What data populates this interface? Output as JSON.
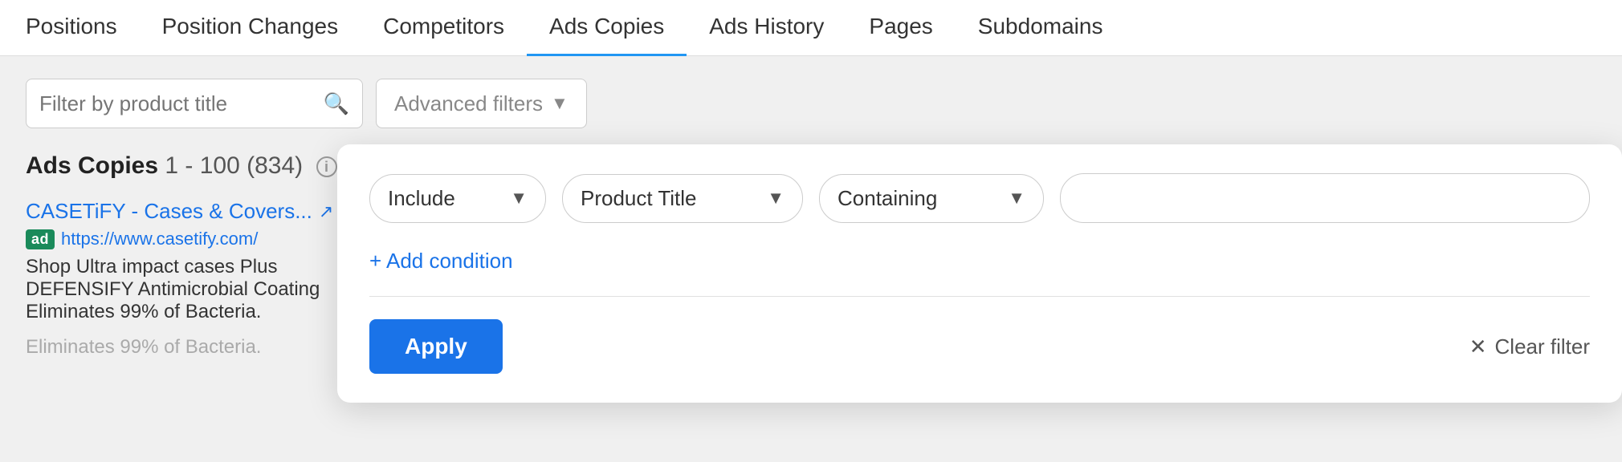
{
  "nav": {
    "items": [
      {
        "label": "Positions",
        "active": false
      },
      {
        "label": "Position Changes",
        "active": false
      },
      {
        "label": "Competitors",
        "active": false
      },
      {
        "label": "Ads Copies",
        "active": true
      },
      {
        "label": "Ads History",
        "active": false
      },
      {
        "label": "Pages",
        "active": false
      },
      {
        "label": "Subdomains",
        "active": false
      }
    ]
  },
  "search": {
    "placeholder": "Filter by product title",
    "icon": "🔍"
  },
  "advanced_filters": {
    "label": "Advanced filters",
    "chevron": "▾"
  },
  "ads_copies_header": {
    "title": "Ads Copies",
    "range": "1 - 100",
    "total": "(834)"
  },
  "ad_item": {
    "title": "CASETiFY - Cases & Covers...",
    "external_icon": "↗",
    "ad_badge": "ad",
    "url": "https://www.casetify.com/",
    "description": "Shop Ultra impact cases Plus DEFENSIFY Antimicrobial Coating Eliminates 99% of Bacteria."
  },
  "bottom_text": "Eliminates 99% of Bacteria.",
  "filter_panel": {
    "include_label": "Include",
    "include_chevron": "▾",
    "field_label": "Product Title",
    "field_chevron": "▾",
    "condition_label": "Containing",
    "condition_chevron": "▾",
    "text_value": "",
    "add_condition_label": "+ Add condition",
    "apply_label": "Apply",
    "clear_filter_label": "Clear filter",
    "clear_x": "✕"
  },
  "colors": {
    "accent_blue": "#1a73e8",
    "ad_badge_green": "#1a8a5a",
    "nav_active_border": "#2196f3"
  }
}
